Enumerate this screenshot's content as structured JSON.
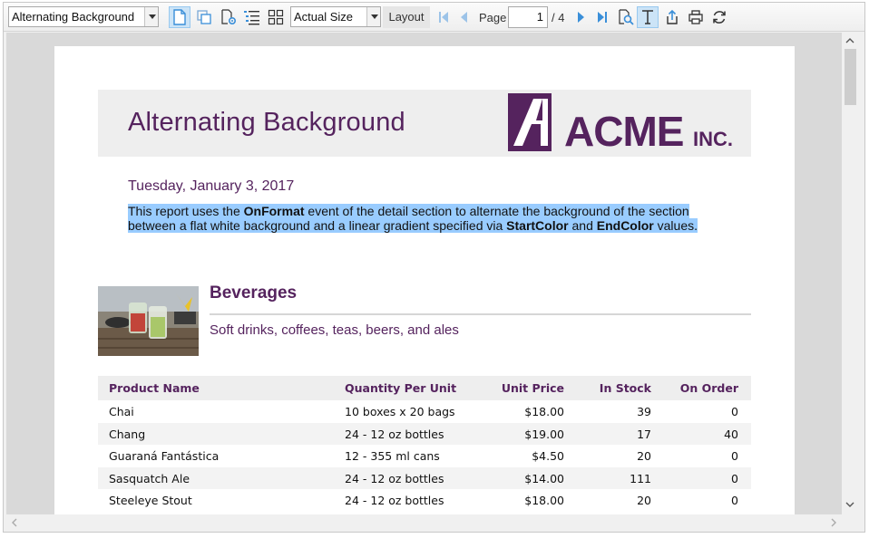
{
  "toolbar": {
    "report_select": "Alternating Background",
    "zoom_select": "Actual Size",
    "layout_label": "Layout",
    "page_label": "Page",
    "page_current": "1",
    "page_total": "/ 4"
  },
  "report": {
    "title": "Alternating Background",
    "logo_text": "ACME",
    "logo_suffix": "INC.",
    "date": "Tuesday, January 3, 2017",
    "desc_1": "This report uses the ",
    "desc_b1": "OnFormat",
    "desc_2": " event of the detail section to alternate the background of the section between a flat white background and a linear gradient specified via ",
    "desc_b2": "StartColor",
    "desc_3": " and ",
    "desc_b3": "EndColor",
    "desc_4": " values."
  },
  "category": {
    "name": "Beverages",
    "description": "Soft drinks, coffees, teas, beers, and ales"
  },
  "table": {
    "headers": [
      "Product Name",
      "Quantity Per Unit",
      "Unit Price",
      "In Stock",
      "On Order"
    ],
    "rows": [
      [
        "Chai",
        "10 boxes x 20 bags",
        "$18.00",
        "39",
        "0"
      ],
      [
        "Chang",
        "24 - 12 oz bottles",
        "$19.00",
        "17",
        "40"
      ],
      [
        "Guaraná Fantástica",
        "12 - 355 ml cans",
        "$4.50",
        "20",
        "0"
      ],
      [
        "Sasquatch Ale",
        "24 - 12 oz bottles",
        "$14.00",
        "111",
        "0"
      ],
      [
        "Steeleye Stout",
        "24 - 12 oz bottles",
        "$18.00",
        "20",
        "0"
      ]
    ]
  },
  "colors": {
    "accent": "#55235e",
    "selection": "#99ccff",
    "toolbar_icon": "#3a8fd9"
  }
}
